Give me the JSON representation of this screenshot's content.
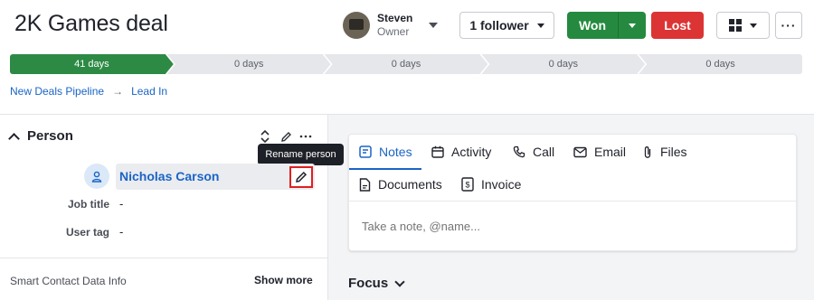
{
  "deal": {
    "title": "2K Games deal"
  },
  "owner": {
    "name": "Steven",
    "role": "Owner"
  },
  "header": {
    "follower_label": "1 follower",
    "won_label": "Won",
    "lost_label": "Lost",
    "more_label": "···"
  },
  "pipeline": {
    "stages": [
      {
        "label": "41 days",
        "active": true
      },
      {
        "label": "0 days",
        "active": false
      },
      {
        "label": "0 days",
        "active": false
      },
      {
        "label": "0 days",
        "active": false
      },
      {
        "label": "0 days",
        "active": false
      }
    ]
  },
  "breadcrumb": {
    "pipeline": "New Deals Pipeline",
    "separator": "→",
    "stage": "Lead In"
  },
  "person": {
    "section_title": "Person",
    "name": "Nicholas Carson",
    "tooltip": "Rename person",
    "fields": [
      {
        "label": "Job title",
        "value": "-"
      },
      {
        "label": "User tag",
        "value": "-"
      }
    ],
    "smart_contact": "Smart Contact Data Info",
    "show_more": "Show more"
  },
  "activity": {
    "tabs": [
      {
        "label": "Notes",
        "icon": "notes-icon"
      },
      {
        "label": "Activity",
        "icon": "calendar-icon"
      },
      {
        "label": "Call",
        "icon": "phone-icon"
      },
      {
        "label": "Email",
        "icon": "envelope-icon"
      },
      {
        "label": "Files",
        "icon": "paperclip-icon"
      },
      {
        "label": "Documents",
        "icon": "document-icon"
      },
      {
        "label": "Invoice",
        "icon": "invoice-icon"
      }
    ],
    "note_placeholder": "Take a note, @name..."
  },
  "focus": {
    "label": "Focus"
  },
  "colors": {
    "won": "#258a3f",
    "lost": "#dc3434",
    "link": "#1b64c5",
    "highlight": "#e01f1f"
  }
}
